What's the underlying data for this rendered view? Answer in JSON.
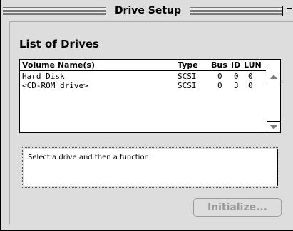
{
  "window": {
    "title": "Drive Setup"
  },
  "main": {
    "heading": "List of Drives",
    "columns": {
      "volume": "Volume Name(s)",
      "type": "Type",
      "bus": "Bus",
      "id": "ID",
      "lun": "LUN"
    },
    "drives": [
      {
        "volume": "Hard Disk",
        "type": "SCSI",
        "bus": "0",
        "id": "0",
        "lun": "0"
      },
      {
        "volume": "<CD-ROM drive>",
        "type": "SCSI",
        "bus": "0",
        "id": "3",
        "lun": "0"
      }
    ],
    "status_message": "Select a drive and then a function.",
    "initialize_label": "Initialize..."
  },
  "icons": {
    "zoom": "zoom-box-icon",
    "scroll_up": "scroll-up-arrow-icon",
    "scroll_down": "scroll-down-arrow-icon"
  }
}
